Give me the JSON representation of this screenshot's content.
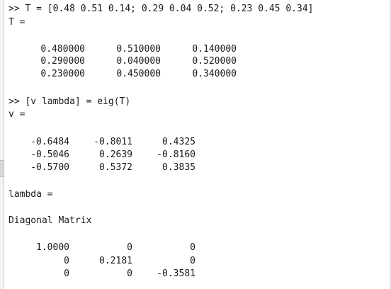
{
  "console": {
    "cmd1": ">> T = [0.48 0.51 0.14; 0.29 0.04 0.52; 0.23 0.45 0.34]",
    "t_label": "T =",
    "T_rows": [
      [
        "0.480000",
        "0.510000",
        "0.140000"
      ],
      [
        "0.290000",
        "0.040000",
        "0.520000"
      ],
      [
        "0.230000",
        "0.450000",
        "0.340000"
      ]
    ],
    "cmd2": ">> [v lambda] = eig(T)",
    "v_label": "v =",
    "v_rows": [
      [
        "-0.6484",
        "-0.8011",
        "0.4325"
      ],
      [
        "-0.5046",
        "0.2639",
        "-0.8160"
      ],
      [
        "-0.5700",
        "0.5372",
        "0.3835"
      ]
    ],
    "lambda_label": "lambda =",
    "diag_label": "Diagonal Matrix",
    "lambda_rows": [
      [
        "1.0000",
        "0",
        "0"
      ],
      [
        "0",
        "0.2181",
        "0"
      ],
      [
        "0",
        "0",
        "-0.3581"
      ]
    ]
  }
}
